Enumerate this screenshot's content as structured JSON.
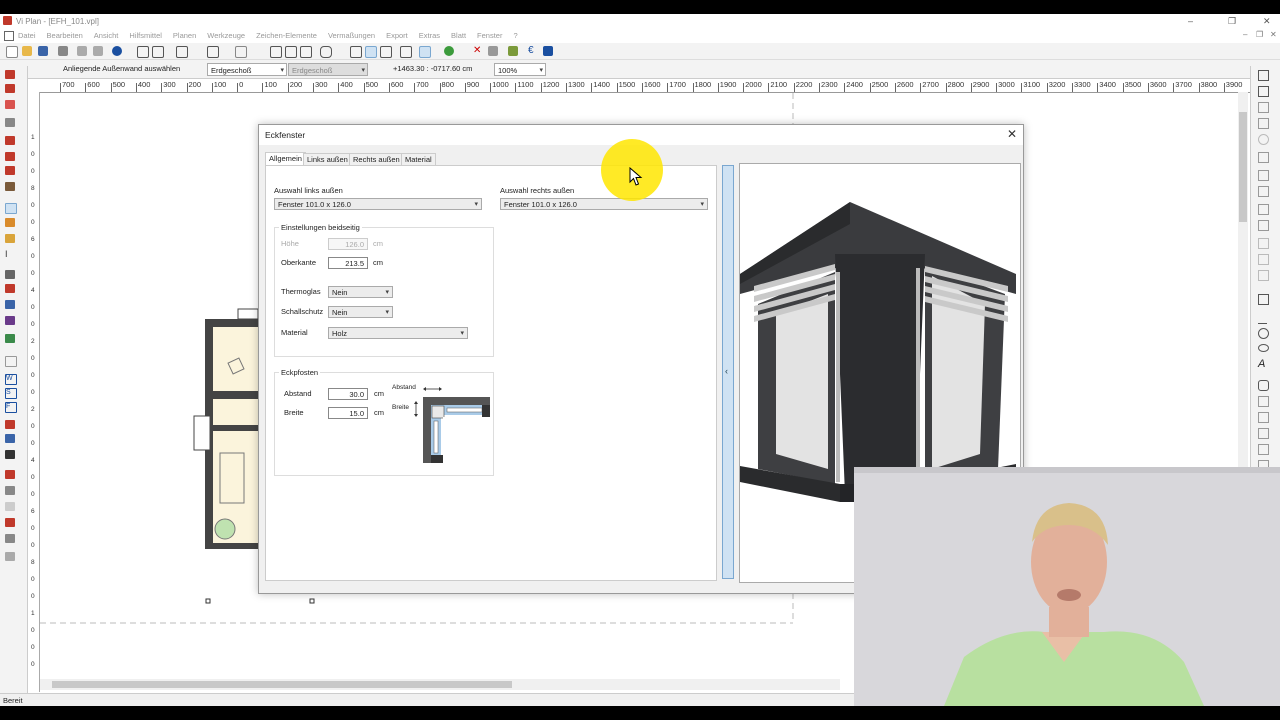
{
  "app": {
    "title": "Vi Plan - [EFH_101.vpl]",
    "window_controls": [
      "–",
      "❐",
      "✕"
    ],
    "child_window_controls": [
      "–",
      "❐",
      "✕"
    ]
  },
  "menu": [
    "Datei",
    "Bearbeiten",
    "Ansicht",
    "Hilfsmittel",
    "Planen",
    "Werkzeuge",
    "Zeichen-Elemente",
    "Vermaßungen",
    "Export",
    "Extras",
    "Blatt",
    "Fenster",
    "?"
  ],
  "toolbar2": {
    "prompt": "Anliegende Außenwand auswählen",
    "floor_select": "Erdgeschoß",
    "floor_select_2": "Erdgeschoß",
    "coordinates": "+1463.30 : -0717.60 cm",
    "zoom": "100%"
  },
  "ruler_top": [
    "700",
    "600",
    "500",
    "400",
    "300",
    "200",
    "100",
    "0",
    "100",
    "200",
    "300",
    "400",
    "500",
    "600",
    "700",
    "800",
    "900",
    "1000",
    "1100",
    "1200",
    "1300",
    "1400",
    "1500",
    "1600",
    "1700",
    "1800",
    "1900",
    "2000",
    "2100",
    "2200",
    "2300",
    "2400",
    "2500",
    "2600",
    "2700",
    "2800",
    "2900",
    "3000",
    "3100",
    "3200",
    "3300",
    "3400",
    "3500",
    "3600",
    "3700",
    "3800",
    "3900"
  ],
  "ruler_left": [
    "1",
    "0",
    "0",
    "8",
    "0",
    "0",
    "6",
    "0",
    "0",
    "4",
    "0",
    "0",
    "2",
    "0",
    "0",
    "0",
    "2",
    "0",
    "0",
    "4",
    "0",
    "0",
    "6",
    "0",
    "0",
    "8",
    "0",
    "0",
    "1",
    "0",
    "0",
    "0"
  ],
  "status": "Bereit",
  "dialog": {
    "title": "Eckfenster",
    "tabs": [
      "Allgemein",
      "Links außen",
      "Rechts außen",
      "Material"
    ],
    "auswahl_links_label": "Auswahl links außen",
    "auswahl_links_value": "Fenster 101.0 x 126.0",
    "auswahl_rechts_label": "Auswahl rechts außen",
    "auswahl_rechts_value": "Fenster 101.0 x 126.0",
    "einstellungen_title": "Einstellungen beidseitig",
    "hoehe_label": "Höhe",
    "hoehe_value": "126.0",
    "hoehe_unit": "cm",
    "oberkante_label": "Oberkante",
    "oberkante_value": "213.5",
    "oberkante_unit": "cm",
    "thermoglas_label": "Thermoglas",
    "thermoglas_value": "Nein",
    "schallschutz_label": "Schallschutz",
    "schallschutz_value": "Nein",
    "material_label": "Material",
    "material_value": "Holz",
    "eckpfosten_title": "Eckpfosten",
    "abstand_label": "Abstand",
    "abstand_value": "30.0",
    "abstand_unit": "cm",
    "breite_label": "Breite",
    "breite_value": "15.0",
    "breite_unit": "cm",
    "diagram_abstand": "Abstand",
    "diagram_breite": "Breite",
    "splitter_glyph": "‹",
    "close_glyph": "✕"
  },
  "colors": {
    "accent_blue": "#cfe2f3",
    "cursor_highlight": "#ffe600",
    "window_frame": "#3a3b3e"
  }
}
